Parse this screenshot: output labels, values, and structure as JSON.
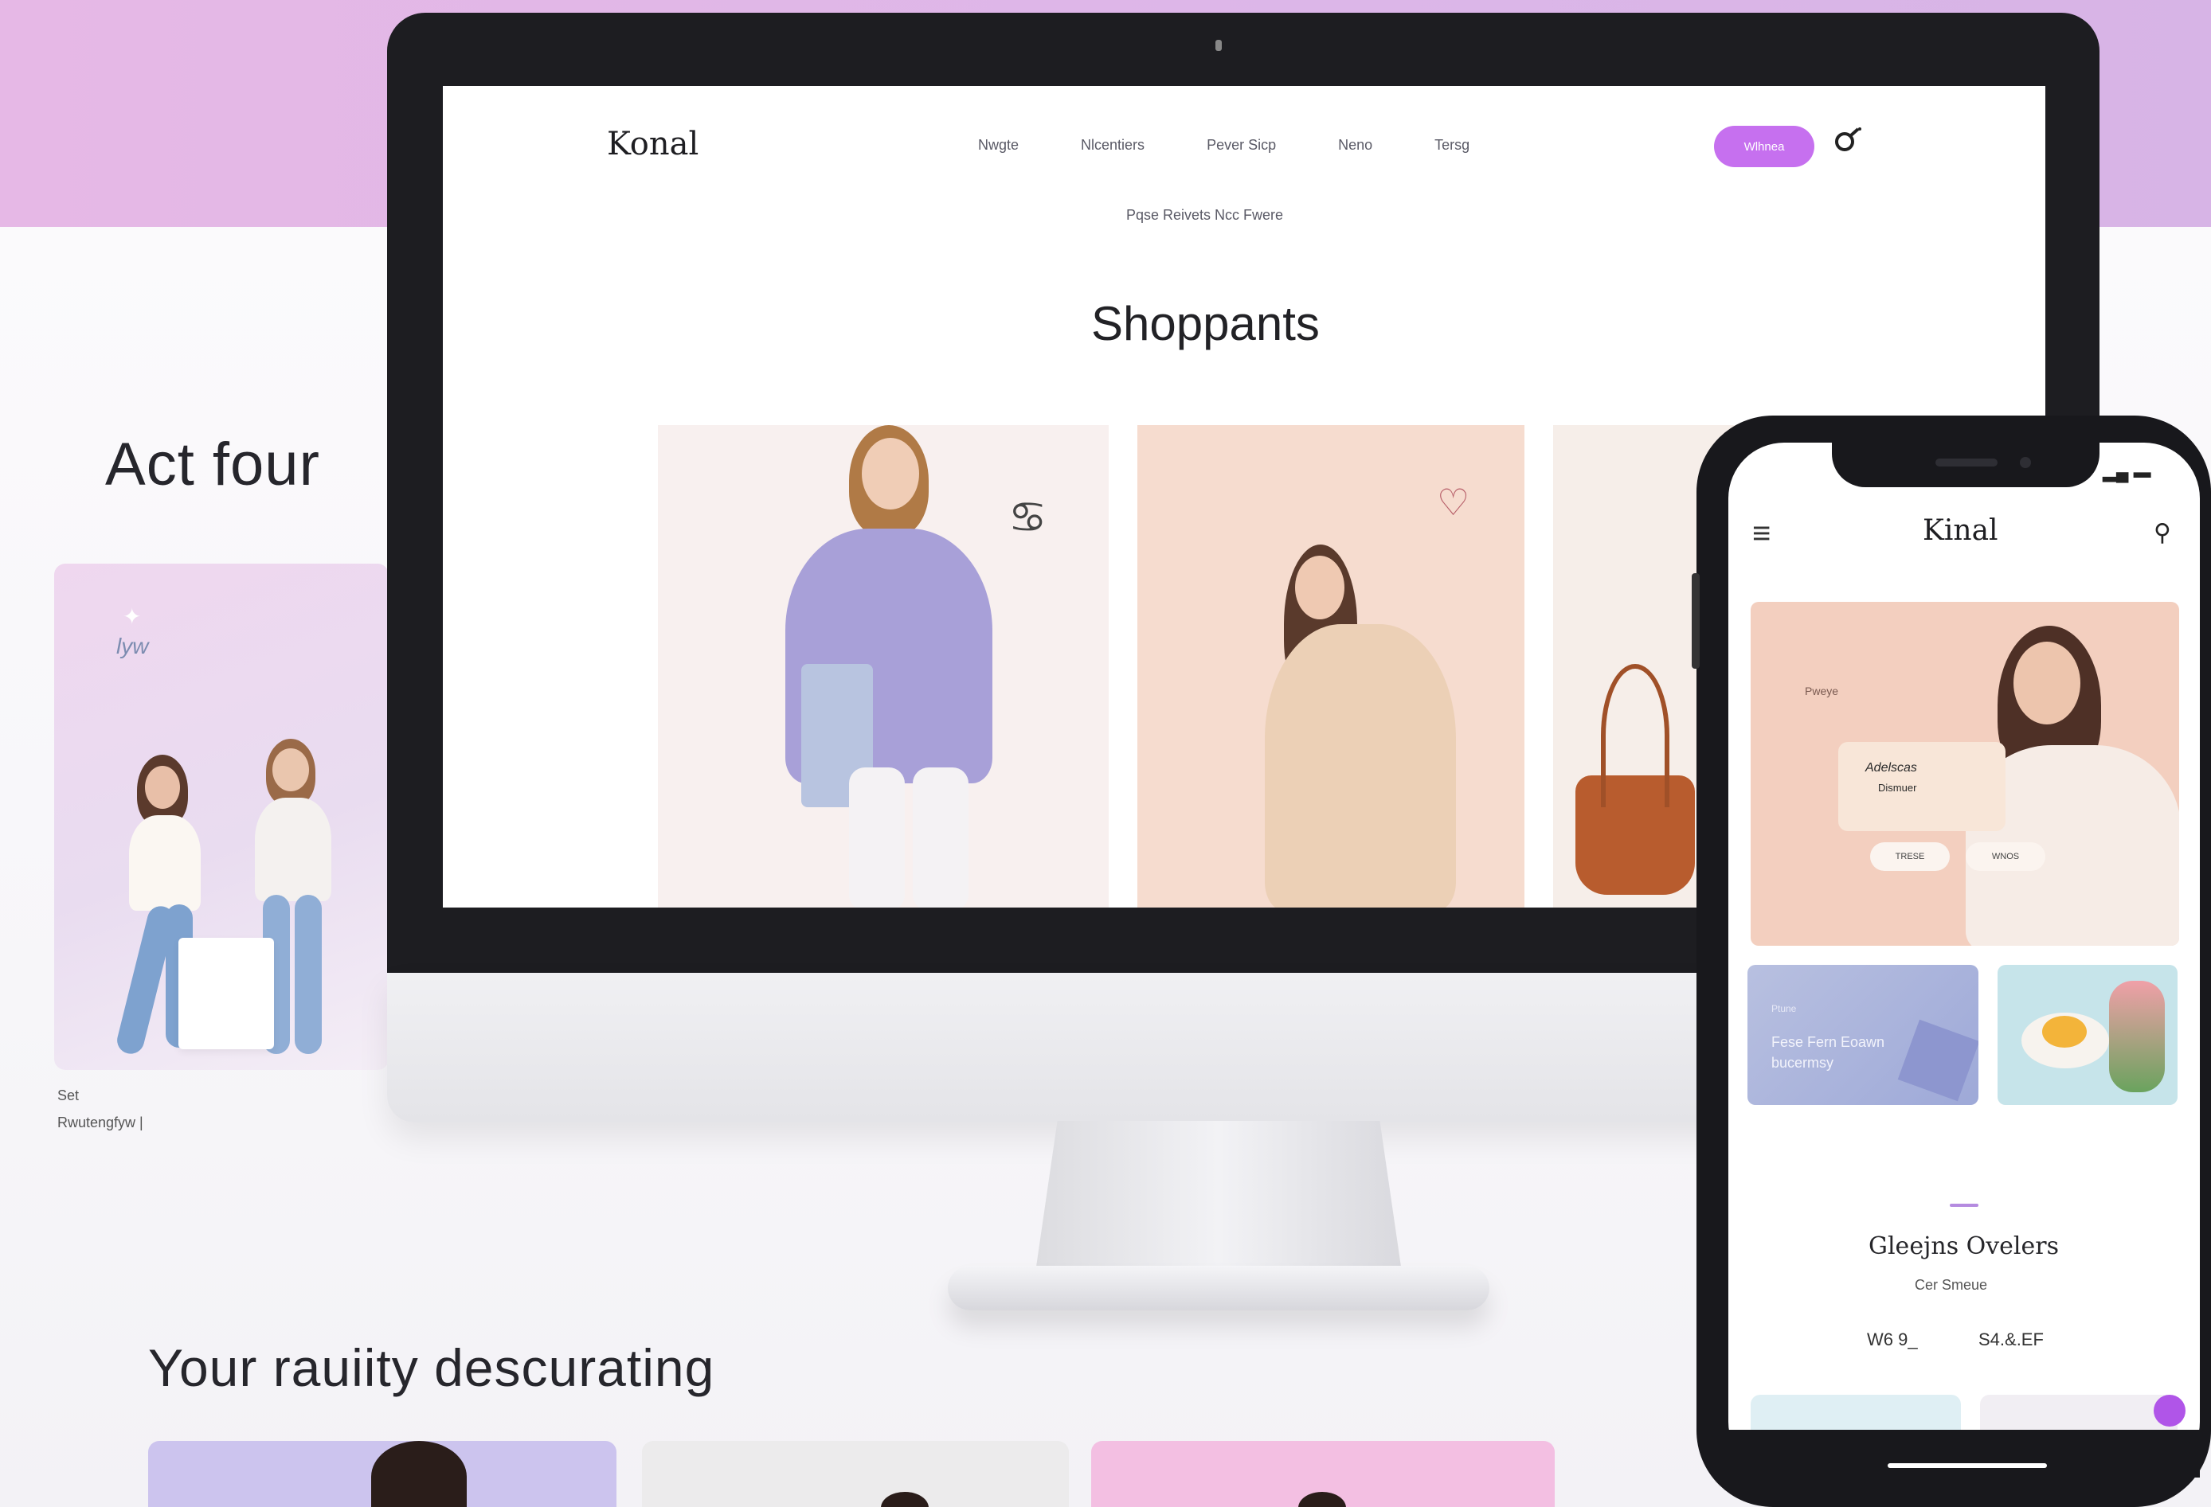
{
  "background": {
    "band_color": "#e2b8e8",
    "left_heading": "Act four",
    "left_card_tag": "lyw",
    "left_caption_1": "Set",
    "left_caption_2": "Rwutengfyw  |",
    "bottom_heading": "Your rauiity descurating"
  },
  "desktop": {
    "logo": "Konal",
    "nav": [
      "Nwgte",
      "Nlcentiers",
      "Pever Sicp",
      "Neno",
      "Tersg"
    ],
    "cta_label": "Wlhnea",
    "user_icon": "user-icon",
    "subnav": "Pqse Reivets  Ncc Fwere",
    "title": "Shoppants",
    "accent_color": "#c670ef"
  },
  "mobile": {
    "menu_icon": "menu-icon",
    "logo": "Kinal",
    "user_icon": "user-icon",
    "hero_label": "Pweye",
    "hero_card_line1": "Adelscas",
    "hero_card_line2": "Dismuer",
    "hero_pill_1": "TRESE",
    "hero_pill_2": "WNOS",
    "tile_1_label": "Ptune",
    "tile_1_text": "Fese Fern Eoawn bucermsy",
    "product_title": "Gleejns Ovelers",
    "product_subtitle": "Cer Smeue",
    "price_1": "W6 9_",
    "price_2": "S4.&.EF"
  }
}
